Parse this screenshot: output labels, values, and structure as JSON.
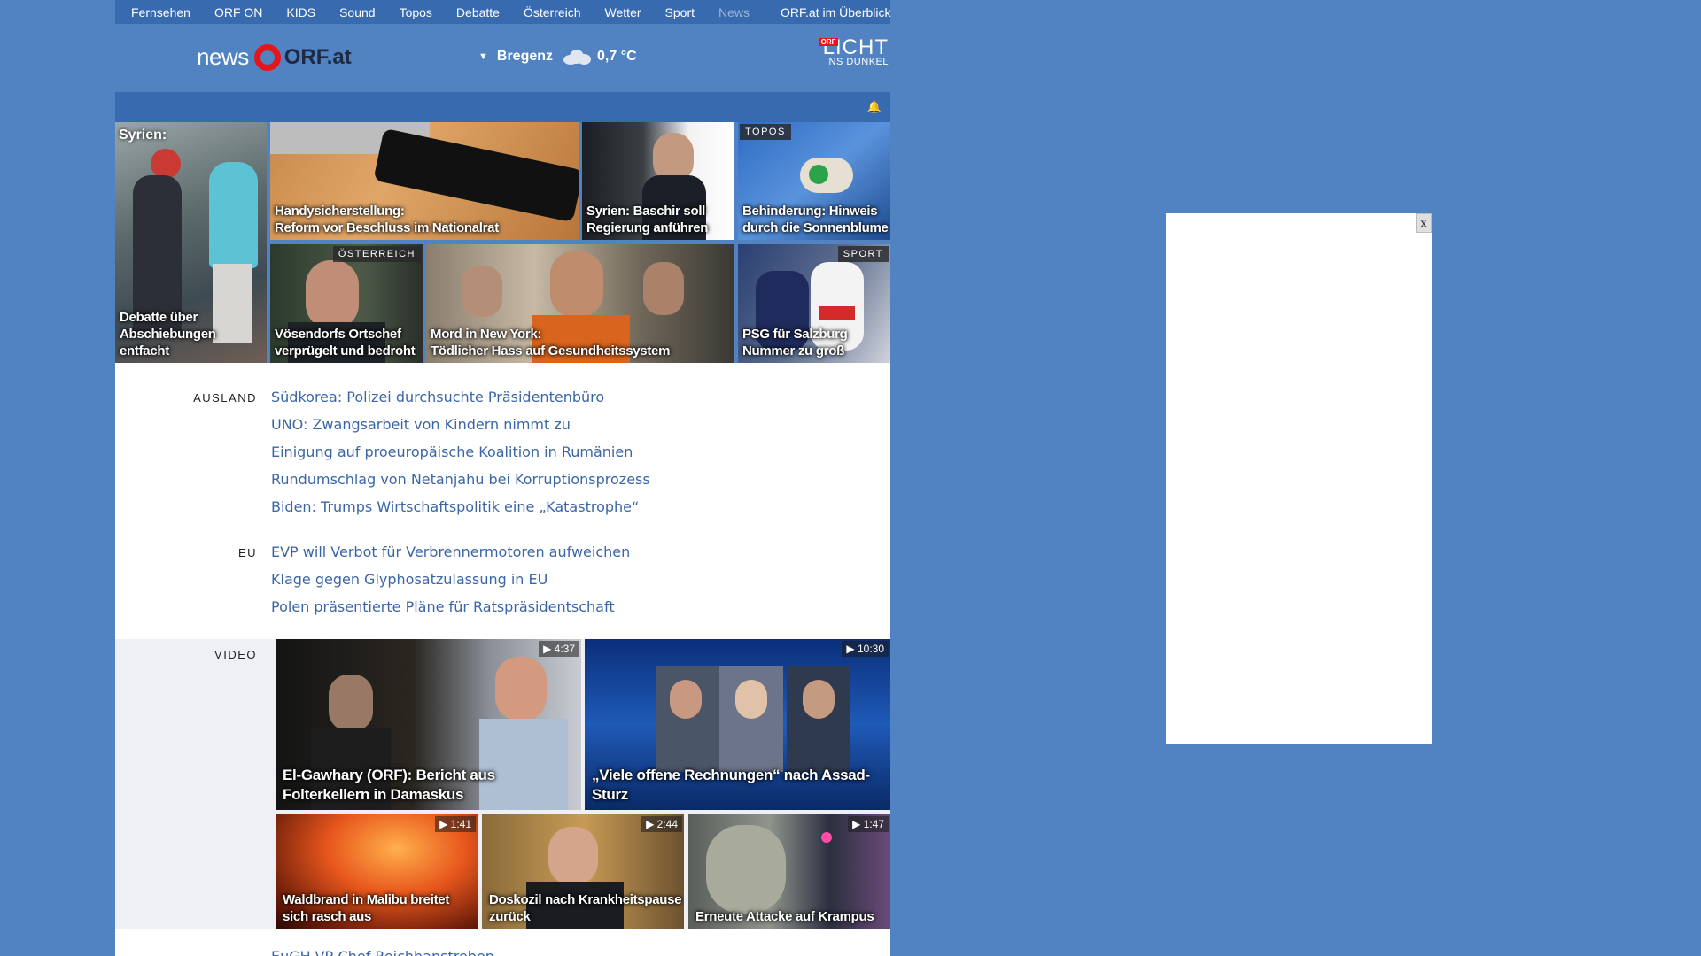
{
  "nav": {
    "items": [
      "Fernsehen",
      "ORF ON",
      "KIDS",
      "Sound",
      "Topos",
      "Debatte",
      "Österreich",
      "Wetter",
      "Sport",
      "News"
    ],
    "overview": "ORF.at im Überblick"
  },
  "header": {
    "logo_news": "news",
    "logo_orf": "ORF.at",
    "weather_city": "Bregenz",
    "weather_temp": "0,7 °C",
    "licht_badge": "ORF",
    "licht_big": "LICHT",
    "licht_small": "INS DUNKEL"
  },
  "tiles": {
    "syrien_top": "Syrien:",
    "syrien_bottom_1": "Debatte über",
    "syrien_bottom_2": "Abschiebungen entfacht",
    "handy_1": "Handysicherstellung:",
    "handy_2": "Reform vor Beschluss im Nationalrat",
    "baschir_1": "Syrien: Baschir soll",
    "baschir_2": "Regierung anführen",
    "topos_tag": "TOPOS",
    "behinderung_1": "Behinderung: Hinweis",
    "behinderung_2": "durch die Sonnenblume",
    "oesterreich_tag": "ÖSTERREICH",
    "voesendorf_1": "Vösendorfs Ortschef",
    "voesendorf_2": "verprügelt und bedroht",
    "mord_1": "Mord in New York:",
    "mord_2": "Tödlicher Hass auf Gesundheitssystem",
    "sport_tag": "SPORT",
    "psg_1": "PSG für Salzburg",
    "psg_2": "Nummer zu groß"
  },
  "ausland": {
    "label": "AUSLAND",
    "links": [
      "Südkorea: Polizei durchsuchte Präsidentenbüro",
      "UNO: Zwangsarbeit von Kindern nimmt zu",
      "Einigung auf proeuropäische Koalition in Rumänien",
      "Rundumschlag von Netanjahu bei Korruptionsprozess",
      "Biden: Trumps Wirtschaftspolitik eine „Katastrophe“"
    ]
  },
  "eu": {
    "label": "EU",
    "links": [
      "EVP will Verbot für Verbrennermotoren aufweichen",
      "Klage gegen Glyphosatzulassung in EU",
      "Polen präsentierte Pläne für Ratspräsidentschaft"
    ]
  },
  "video": {
    "label": "VIDEO",
    "items": [
      {
        "duration": "▶ 4:37",
        "line1": "El-Gawhary (ORF): Bericht aus",
        "line2": "Folterkellern in Damaskus"
      },
      {
        "duration": "▶ 10:30",
        "line1": "„Viele offene Rechnungen“ nach Assad-",
        "line2": "Sturz"
      },
      {
        "duration": "▶ 1:41",
        "line1": "Waldbrand in Malibu breitet",
        "line2": "sich rasch aus"
      },
      {
        "duration": "▶ 2:44",
        "line1": "Doskozil nach Krankheitspause",
        "line2": "zurück"
      },
      {
        "duration": "▶ 1:47",
        "line1": "",
        "line2": "Erneute Attacke auf Krampus"
      }
    ]
  },
  "bottom_link": "EuGH-VP-Chef Reichhanstreben…",
  "ad": {
    "close": "x"
  }
}
